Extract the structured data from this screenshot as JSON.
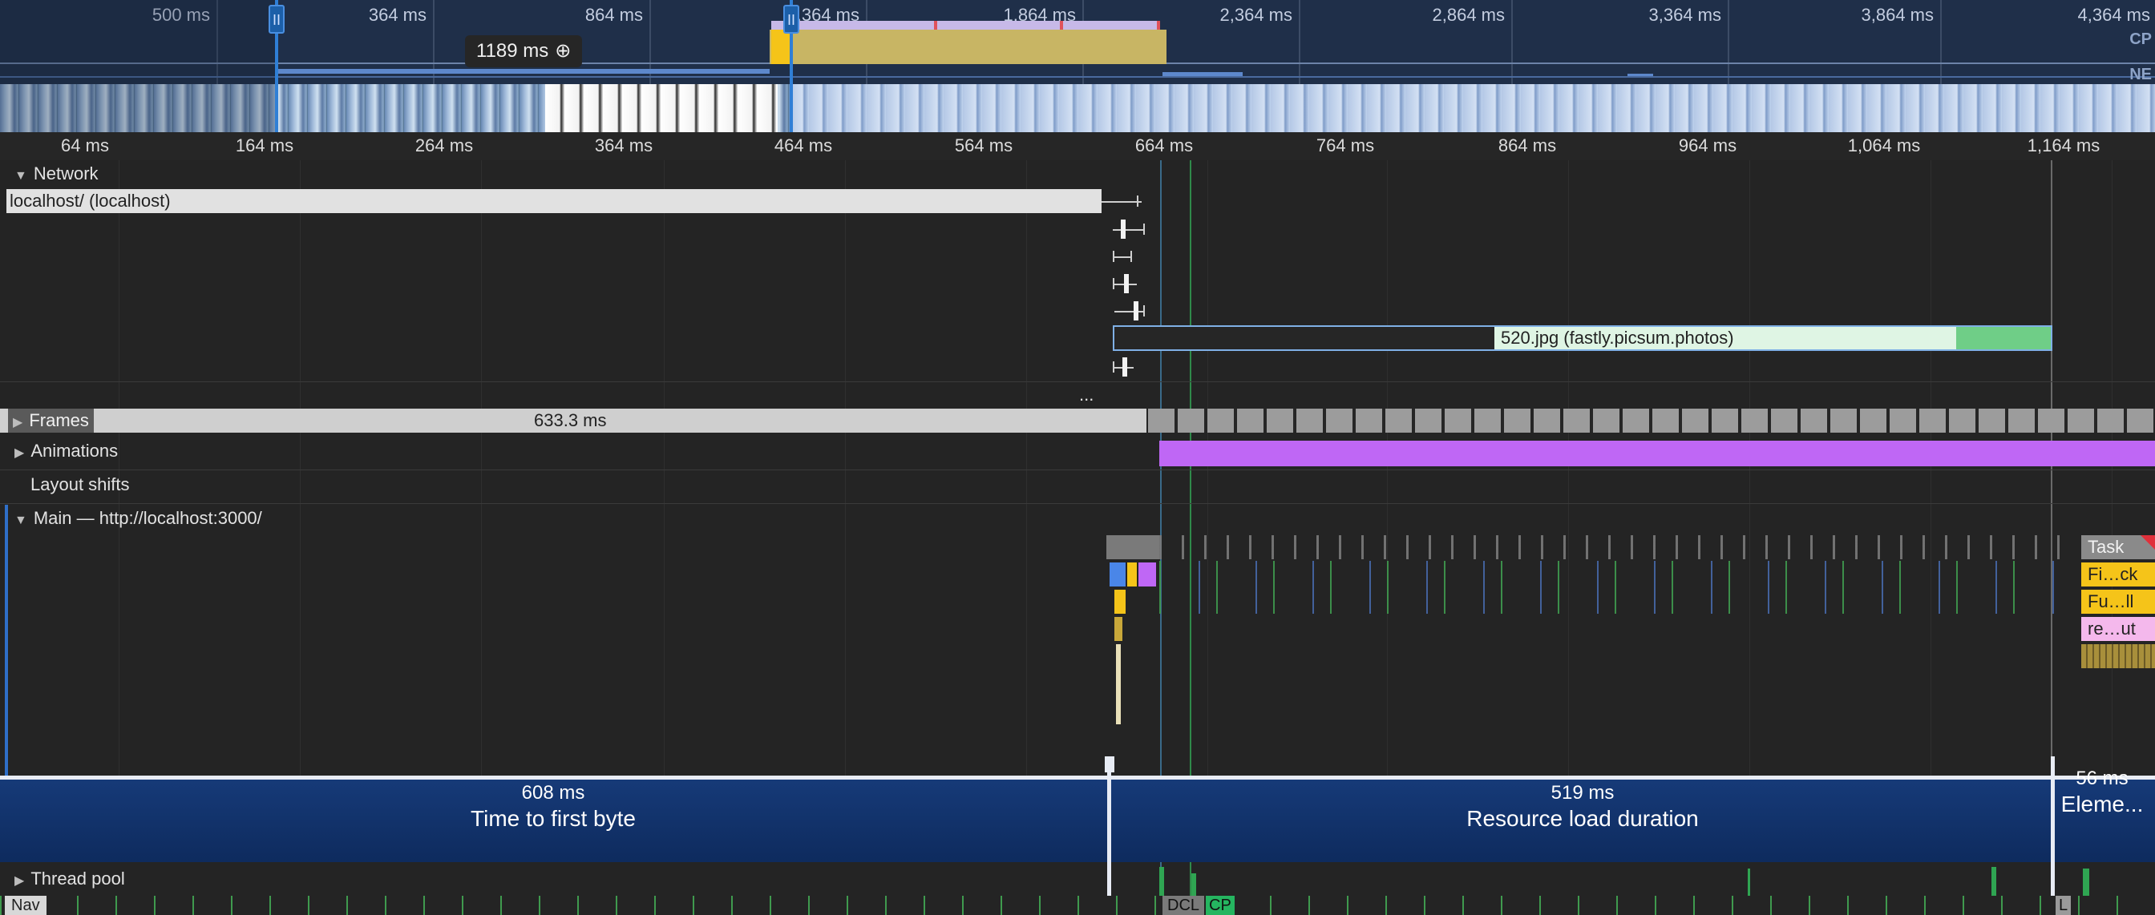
{
  "overview": {
    "ticks": [
      "500 ms",
      "364 ms",
      "864 ms",
      "1,364 ms",
      "1,864 ms",
      "2,364 ms",
      "2,864 ms",
      "3,364 ms",
      "3,864 ms",
      "4,364 ms"
    ],
    "cpu_label": "CP",
    "net_label": "NE",
    "handle_glyph": "II",
    "zoom_label": "1189 ms",
    "zoom_icon": "zoom-in-icon"
  },
  "ruler": {
    "ticks": [
      "64 ms",
      "164 ms",
      "264 ms",
      "364 ms",
      "464 ms",
      "564 ms",
      "664 ms",
      "764 ms",
      "864 ms",
      "964 ms",
      "1,064 ms",
      "1,164 ms"
    ]
  },
  "tracks": {
    "network": {
      "title": "Network",
      "main_request": "localhost/ (localhost)",
      "image_request": "520.jpg (fastly.picsum.photos)",
      "more": "..."
    },
    "frames": {
      "title": "Frames",
      "duration": "633.3 ms"
    },
    "animations": {
      "title": "Animations"
    },
    "layout_shifts": {
      "title": "Layout shifts"
    },
    "main": {
      "title": "Main — http://localhost:3000/",
      "task_labels": [
        "Task",
        "Fi…ck",
        "Fu…ll",
        "re…ut"
      ]
    },
    "thread_pool": {
      "title": "Thread pool"
    }
  },
  "insight": {
    "phases": [
      {
        "duration": "608 ms",
        "label": "Time to first byte"
      },
      {
        "duration": "519 ms",
        "label": "Resource load duration"
      },
      {
        "duration": "56 ms",
        "label": "Eleme..."
      }
    ]
  },
  "markers": {
    "nav": "Nav",
    "dcl": "DCL",
    "lcp": "CP",
    "l": "L"
  },
  "colors": {
    "overview_bg": "#1f2f49",
    "selection": "#2f7fd6",
    "frames": "#cfcfcf",
    "animation": "#bf67f5",
    "scripting": "#f5c419",
    "rendering": "#f4b8ec",
    "network_image": "#6fce87",
    "insight_bg": "#163a78",
    "lcp": "#25b560"
  }
}
